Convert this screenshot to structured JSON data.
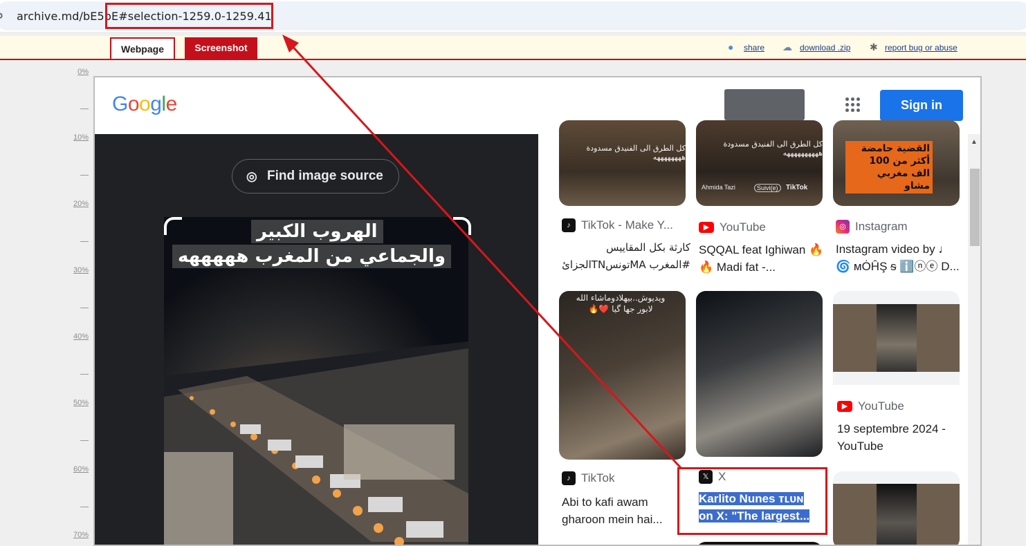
{
  "browser": {
    "url": "archive.md/bE5pE#selection-1259.0-1259.41",
    "site_icon": "site-settings-icon"
  },
  "archive_bar": {
    "tabs": [
      {
        "label": "Webpage",
        "active": true
      },
      {
        "label": "Screenshot",
        "active": false
      }
    ],
    "links": [
      {
        "label": "share",
        "icon": "share-icon"
      },
      {
        "label": "download .zip",
        "icon": "cloud-download-icon"
      },
      {
        "label": "report bug or abuse",
        "icon": "bug-icon"
      }
    ]
  },
  "ruler": {
    "labels": [
      "0%",
      "10%",
      "20%",
      "30%",
      "40%",
      "50%",
      "60%",
      "70%"
    ]
  },
  "google": {
    "logo": "Google",
    "signin_label": "Sign in",
    "apps_icon": "apps-grid-icon"
  },
  "viewer": {
    "find_source_label": "Find image source",
    "caption_line1": "الهروب الكبير",
    "caption_line2": "والجماعي من المغرب هههههه"
  },
  "results": [
    {
      "source": "TikTok - Make Y...",
      "source_icon": "tiktok-icon",
      "title": "كارثة بكل المقاييس #المغرب MAتونسTNالجزائ ...|"
    },
    {
      "source": "YouTube",
      "source_icon": "youtube-icon",
      "title": "SQQAL feat Ighiwan 🔥 🔥 Madi fat -..."
    },
    {
      "source": "Instagram",
      "source_icon": "instagram-icon",
      "title": "Instagram video by ♩ 🌀 ᴍȮĤŞ ᵴ ℹ️ⓝⓔ D..."
    },
    {
      "source": "TikTok",
      "source_icon": "tiktok-icon",
      "title": "Abi to kafi awam gharoon mein hai..."
    },
    {
      "source": "X",
      "source_icon": "x-icon",
      "title_line1": "Karlito Nunes ᴛʟᴜɴ",
      "title_line2": "on X: \"The largest..."
    },
    {
      "source": "YouTube",
      "source_icon": "youtube-icon",
      "title": "19 septembre 2024 - YouTube"
    }
  ],
  "thumb_texts": {
    "t1": "كل الطرق الى الفنيدق مسدودة ههههههههه",
    "t2": "كل الطرق الى الفنيدق مسدودة ههههههههههه",
    "t2_user": "Ahmida Tazi",
    "t2_follow": "Suivi(e)",
    "t2_brand": "TikTok",
    "t3": "القضية حامضة أكثر من 100 الف مغربي مشاو",
    "t4": "ويديوش..بيهلادوماشاء الله لابور جها گيا ❤️🔥"
  },
  "colors": {
    "archive_red": "#c4101b",
    "annotation_red": "#d8161b",
    "google_blue": "#1a73e8",
    "selection_blue": "#3d6dcc",
    "viewer_bg": "#202124"
  }
}
